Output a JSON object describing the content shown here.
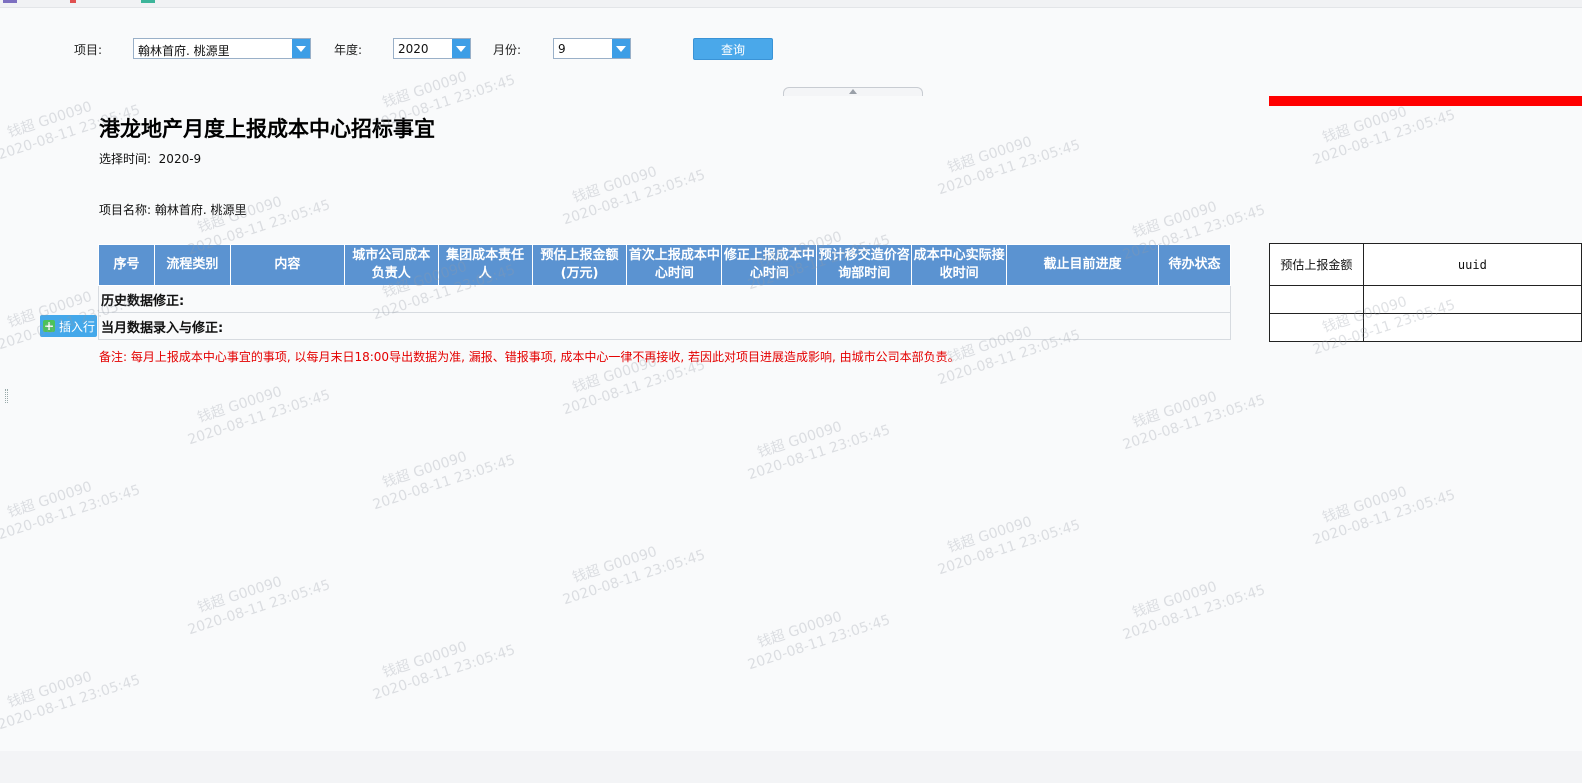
{
  "filters": {
    "project": {
      "label": "项目:",
      "value": "翰林首府. 桃源里"
    },
    "year": {
      "label": "年度:",
      "value": "2020"
    },
    "month": {
      "label": "月份:",
      "value": "9"
    },
    "query_label": "查询"
  },
  "report": {
    "title": "港龙地产月度上报成本中心招标事宜",
    "select_time": "选择时间:  2020-9",
    "project_name": "项目名称: 翰林首府. 桃源里",
    "columns": [
      "序号",
      "流程类别",
      "内容",
      "城市公司成本负责人",
      "集团成本责任人",
      "预估上报金额(万元)",
      "首次上报成本中心时间",
      "修正上报成本中心时间",
      "预计移交造价咨询部时间",
      "成本中心实际接收时间",
      "截止目前进度",
      "待办状态"
    ],
    "sections": [
      "历史数据修正:",
      "当月数据录入与修正:"
    ],
    "insert_row_label": "插入行",
    "remark": "备注: 每月上报成本中心事宜的事项, 以每月末日18:00导出数据为准, 漏报、错报事项, 成本中心一律不再接收, 若因此对项目进展造成影响, 由城市公司本部负责。"
  },
  "side_table": {
    "headers": [
      "预估上报金额",
      "uuid"
    ]
  },
  "watermark": {
    "name": "钱超 G00090",
    "time": "2020-08-11 23:05:45"
  },
  "colors": {
    "header_blue": "#5b93d1",
    "button_blue": "#4aa8ea",
    "remark_red": "#e40000",
    "alert_red": "#ff0000"
  }
}
